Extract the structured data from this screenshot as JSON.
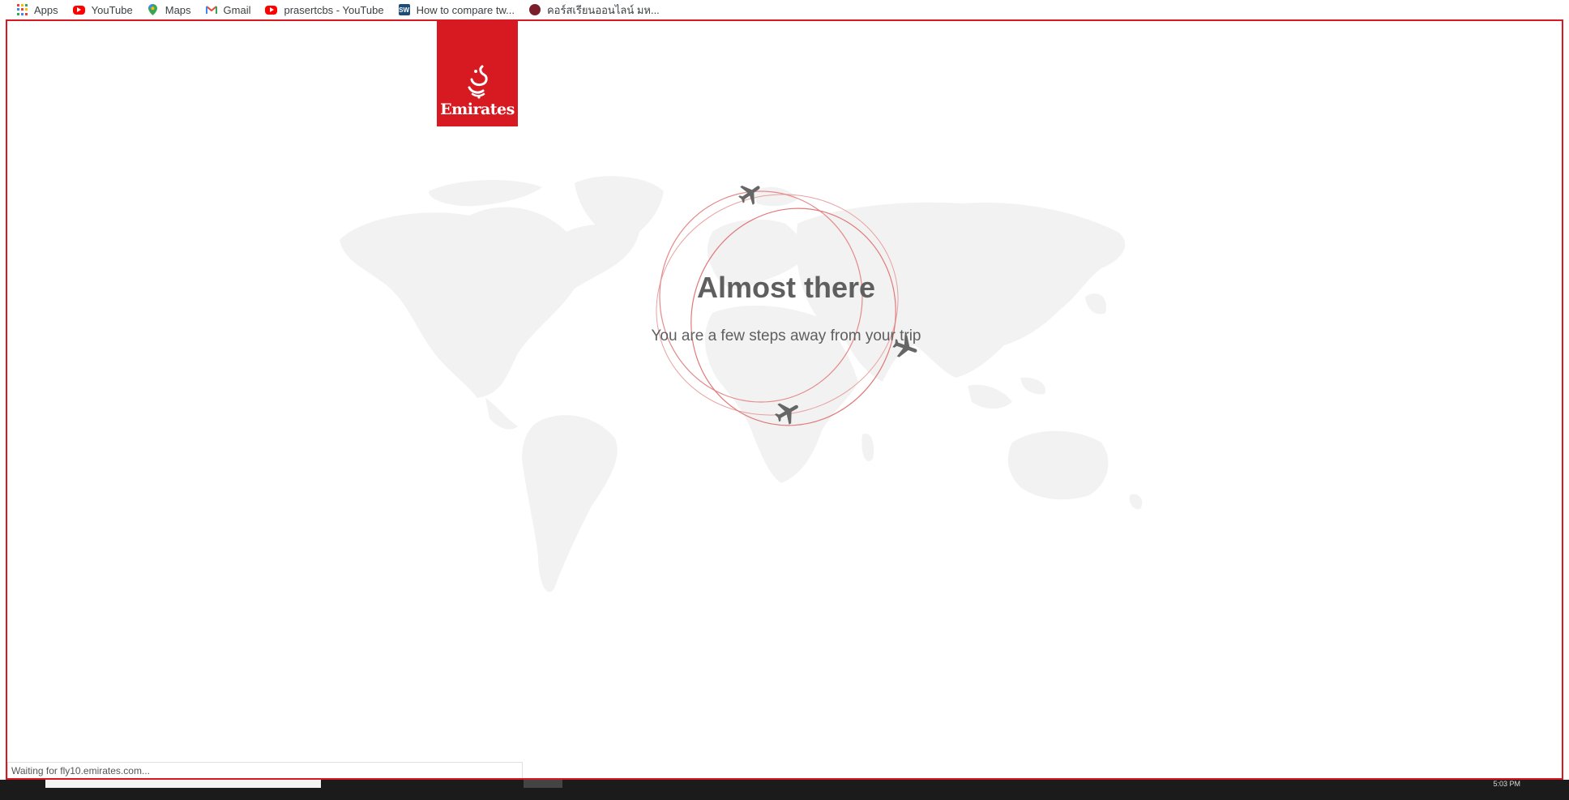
{
  "bookmarks": [
    {
      "label": "Apps",
      "icon": "apps-grid-icon"
    },
    {
      "label": "YouTube",
      "icon": "youtube-icon"
    },
    {
      "label": "Maps",
      "icon": "maps-pin-icon"
    },
    {
      "label": "Gmail",
      "icon": "gmail-icon"
    },
    {
      "label": "prasertcbs - YouTube",
      "icon": "youtube-icon"
    },
    {
      "label": "How to compare tw...",
      "icon": "sw-icon"
    },
    {
      "label": "คอร์สเรียนออนไลน์ มห...",
      "icon": "course-icon"
    }
  ],
  "brand": {
    "name": "Emirates",
    "color": "#d71921"
  },
  "loading": {
    "headline": "Almost there",
    "subtitle": "You are a few steps away from your trip"
  },
  "status_bar": {
    "text": "Waiting for fly10.emirates.com..."
  },
  "taskbar": {
    "clock": "5:03 PM"
  },
  "colors": {
    "accent": "#d71921",
    "text": "#5f5f5f",
    "map": "#f2f2f2",
    "plane": "#666666"
  }
}
